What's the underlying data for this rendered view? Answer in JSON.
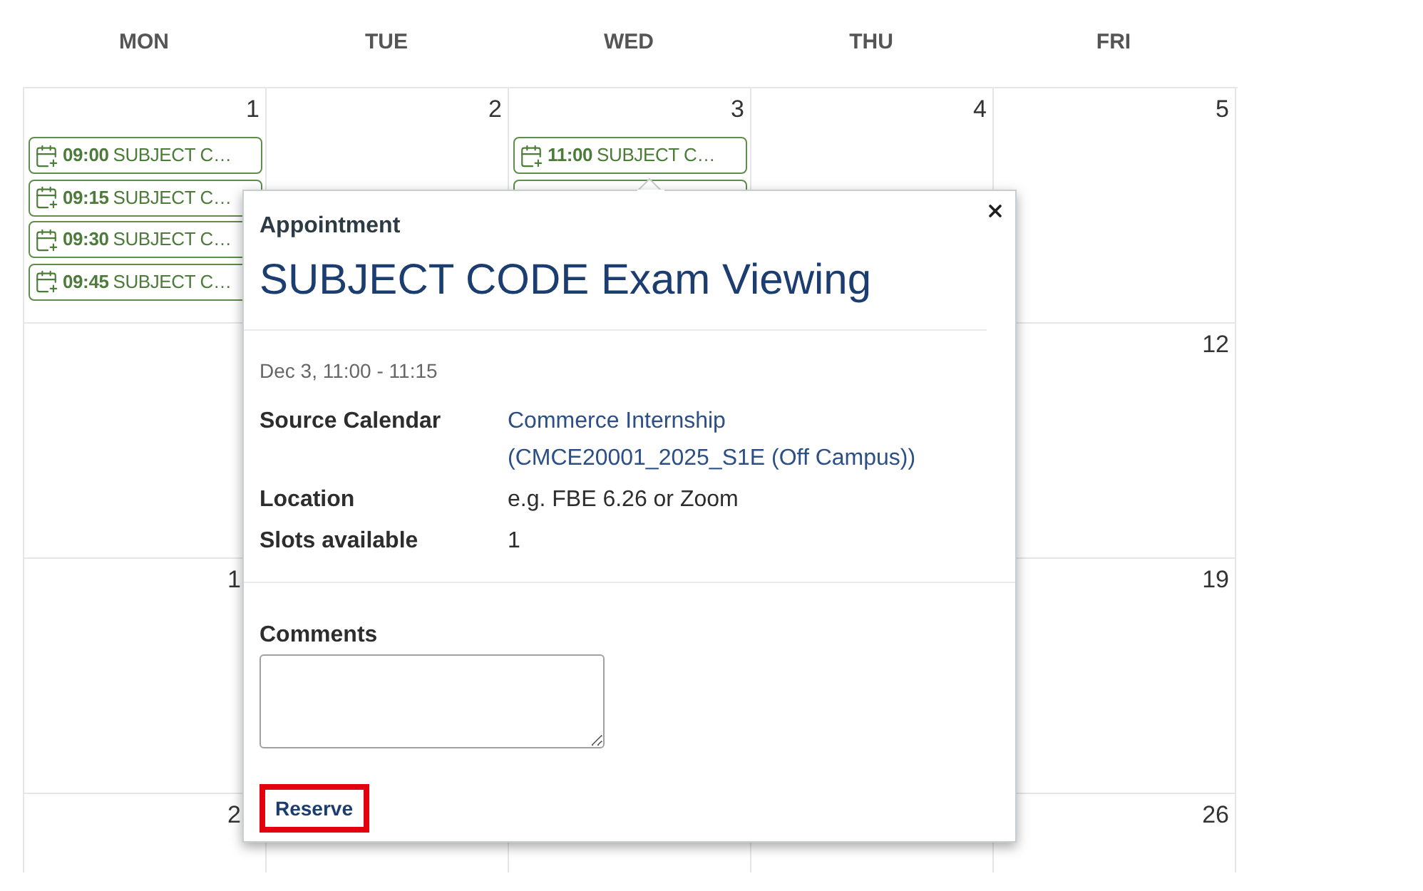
{
  "calendar": {
    "day_headers": [
      "MON",
      "TUE",
      "WED",
      "THU",
      "FRI"
    ],
    "weeks": [
      {
        "cells": [
          {
            "day": "1",
            "events": [
              {
                "kind": "chip",
                "time": "09:00",
                "title": "SUBJECT C…"
              },
              {
                "kind": "chip",
                "time": "09:15",
                "title": "SUBJECT C…"
              },
              {
                "kind": "chip",
                "time": "09:30",
                "title": "SUBJECT C…"
              },
              {
                "kind": "chip",
                "time": "09:45",
                "title": "SUBJECT C…"
              }
            ]
          },
          {
            "day": "2"
          },
          {
            "day": "3",
            "events": [
              {
                "kind": "chip",
                "time": "11:00",
                "title": "SUBJECT C…"
              },
              {
                "kind": "covered"
              }
            ]
          },
          {
            "day": "4"
          },
          {
            "day": "5"
          }
        ]
      },
      {
        "cells": [
          {},
          {},
          {},
          {},
          {
            "day": "12"
          }
        ]
      },
      {
        "cells": [
          {
            "day": "1"
          },
          {},
          {},
          {},
          {
            "day": "19"
          }
        ]
      },
      {
        "cells": [
          {
            "day": "2"
          },
          {},
          {},
          {},
          {
            "day": "26"
          }
        ]
      }
    ]
  },
  "popover": {
    "heading": "Appointment",
    "title": "SUBJECT CODE Exam Viewing",
    "time": "Dec 3, 11:00 - 11:15",
    "details": [
      {
        "label": "Source Calendar",
        "value": "Commerce Internship (CMCE20001_2025_S1E (Off Campus))",
        "kind": "link"
      },
      {
        "label": "Location",
        "value": "e.g. FBE 6.26 or Zoom",
        "kind": "text"
      },
      {
        "label": "Slots available",
        "value": "1",
        "kind": "text"
      }
    ],
    "comments": {
      "label": "Comments"
    },
    "reserve": {
      "label": "Reserve",
      "highlighted": true
    }
  }
}
